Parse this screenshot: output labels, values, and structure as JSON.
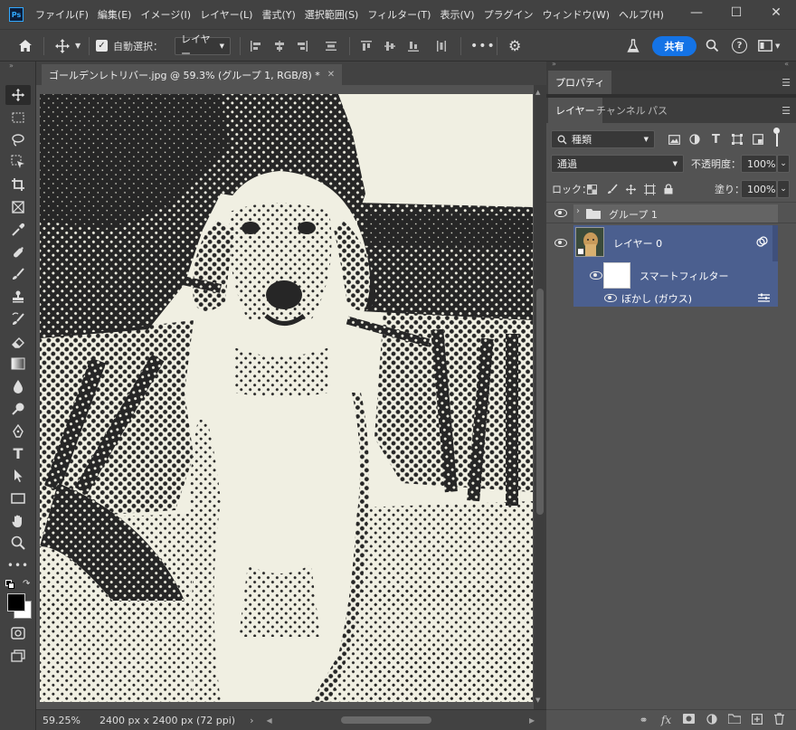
{
  "menu": {
    "logo": "Ps",
    "items": [
      "ファイル(F)",
      "編集(E)",
      "イメージ(I)",
      "レイヤー(L)",
      "書式(Y)",
      "選択範囲(S)",
      "フィルター(T)",
      "表示(V)",
      "プラグイン",
      "ウィンドウ(W)",
      "ヘルプ(H)"
    ]
  },
  "options": {
    "auto_select_label": "自動選択：",
    "auto_select_checked": true,
    "target_value": "レイヤー",
    "share_label": "共有",
    "accent": "#1473e6"
  },
  "document": {
    "tab_title": "ゴールデンレトリバー.jpg @ 59.3% (グループ 1, RGB/8) *",
    "zoom": "59.25%",
    "info": "2400 px x 2400 px (72 ppi)"
  },
  "panels": {
    "properties_tab": "プロパティ",
    "tabs": [
      "レイヤー",
      "チャンネル",
      "パス"
    ],
    "filter_kind": "種類",
    "blend_mode": "通過",
    "opacity_label": "不透明度：",
    "opacity_value": "100%",
    "lock_label": "ロック：",
    "fill_label": "塗り：",
    "fill_value": "100%"
  },
  "layers": [
    {
      "name": "グループ 1",
      "type": "group",
      "selected": false
    },
    {
      "name": "レイヤー 0",
      "type": "smart-object",
      "selected": true
    },
    {
      "name": "スマートフィルター",
      "type": "smart-filter",
      "selected": true
    },
    {
      "name": "ぼかし (ガウス)",
      "type": "filter",
      "selected": true
    }
  ],
  "colors": {
    "selected_layer": "#4b5f8f",
    "halftone_ink": "#262626",
    "halftone_paper": "#f0efe2"
  }
}
